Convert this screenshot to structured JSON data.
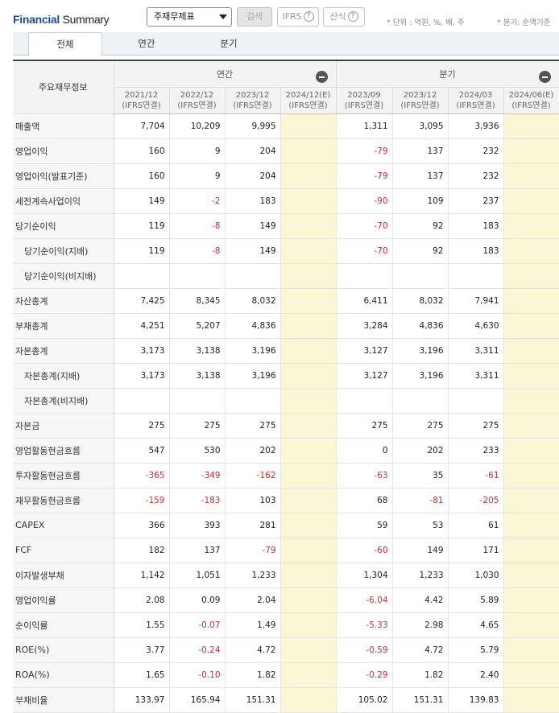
{
  "header": {
    "title_bold": "Financial",
    "title_rest": " Summary",
    "select_value": "주재무제표",
    "search_label": "검색",
    "ifrs_label": "IFRS",
    "calc_label": "산식",
    "help_glyph": "?",
    "unit_note": "* 단위 : 억원, %, 배, 주",
    "quarter_note": "* 분기: 순액기준"
  },
  "tabs": [
    "전체",
    "연간",
    "분기"
  ],
  "table": {
    "label_header": "주요재무정보",
    "annual_label": "연간",
    "quarter_label": "분기",
    "periods": [
      {
        "date": "2021/12",
        "basis": "(IFRS연결)"
      },
      {
        "date": "2022/12",
        "basis": "(IFRS연결)"
      },
      {
        "date": "2023/12",
        "basis": "(IFRS연결)"
      },
      {
        "date": "2024/12(E)",
        "basis": "(IFRS연결)"
      },
      {
        "date": "2023/09",
        "basis": "(IFRS연결)"
      },
      {
        "date": "2023/12",
        "basis": "(IFRS연결)"
      },
      {
        "date": "2024/03",
        "basis": "(IFRS연결)"
      },
      {
        "date": "2024/06(E)",
        "basis": "(IFRS연결)"
      }
    ],
    "rows": [
      {
        "label": "매출액",
        "indent": false,
        "values": [
          "7,704",
          "10,209",
          "9,995",
          "",
          "1,311",
          "3,095",
          "3,936",
          ""
        ]
      },
      {
        "label": "영업이익",
        "indent": false,
        "values": [
          "160",
          "9",
          "204",
          "",
          "-79",
          "137",
          "232",
          ""
        ]
      },
      {
        "label": "영업이익(발표기준)",
        "indent": false,
        "values": [
          "160",
          "9",
          "204",
          "",
          "-79",
          "137",
          "232",
          ""
        ]
      },
      {
        "label": "세전계속사업이익",
        "indent": false,
        "values": [
          "149",
          "-2",
          "183",
          "",
          "-90",
          "109",
          "237",
          ""
        ]
      },
      {
        "label": "당기순이익",
        "indent": false,
        "values": [
          "119",
          "-8",
          "149",
          "",
          "-70",
          "92",
          "183",
          ""
        ]
      },
      {
        "label": "당기순이익(지배)",
        "indent": true,
        "values": [
          "119",
          "-8",
          "149",
          "",
          "-70",
          "92",
          "183",
          ""
        ]
      },
      {
        "label": "당기순이익(비지배)",
        "indent": true,
        "values": [
          "",
          "",
          "",
          "",
          "",
          "",
          "",
          ""
        ]
      },
      {
        "label": "자산총계",
        "indent": false,
        "values": [
          "7,425",
          "8,345",
          "8,032",
          "",
          "6,411",
          "8,032",
          "7,941",
          ""
        ]
      },
      {
        "label": "부채총계",
        "indent": false,
        "values": [
          "4,251",
          "5,207",
          "4,836",
          "",
          "3,284",
          "4,836",
          "4,630",
          ""
        ]
      },
      {
        "label": "자본총계",
        "indent": false,
        "values": [
          "3,173",
          "3,138",
          "3,196",
          "",
          "3,127",
          "3,196",
          "3,311",
          ""
        ]
      },
      {
        "label": "자본총계(지배)",
        "indent": true,
        "values": [
          "3,173",
          "3,138",
          "3,196",
          "",
          "3,127",
          "3,196",
          "3,311",
          ""
        ]
      },
      {
        "label": "자본총계(비지배)",
        "indent": true,
        "values": [
          "",
          "",
          "",
          "",
          "",
          "",
          "",
          ""
        ]
      },
      {
        "label": "자본금",
        "indent": false,
        "values": [
          "275",
          "275",
          "275",
          "",
          "275",
          "275",
          "275",
          ""
        ]
      },
      {
        "label": "영업활동현금흐름",
        "indent": false,
        "values": [
          "547",
          "530",
          "202",
          "",
          "0",
          "202",
          "233",
          ""
        ]
      },
      {
        "label": "투자활동현금흐름",
        "indent": false,
        "values": [
          "-365",
          "-349",
          "-162",
          "",
          "-63",
          "35",
          "-61",
          ""
        ]
      },
      {
        "label": "재무활동현금흐름",
        "indent": false,
        "values": [
          "-159",
          "-183",
          "103",
          "",
          "68",
          "-81",
          "-205",
          ""
        ]
      },
      {
        "label": "CAPEX",
        "indent": false,
        "values": [
          "366",
          "393",
          "281",
          "",
          "59",
          "53",
          "61",
          ""
        ]
      },
      {
        "label": "FCF",
        "indent": false,
        "values": [
          "182",
          "137",
          "-79",
          "",
          "-60",
          "149",
          "171",
          ""
        ]
      },
      {
        "label": "이자발생부채",
        "indent": false,
        "values": [
          "1,142",
          "1,051",
          "1,233",
          "",
          "1,304",
          "1,233",
          "1,030",
          ""
        ]
      },
      {
        "label": "영업이익률",
        "indent": false,
        "values": [
          "2.08",
          "0.09",
          "2.04",
          "",
          "-6.04",
          "4.42",
          "5.89",
          ""
        ]
      },
      {
        "label": "순이익률",
        "indent": false,
        "values": [
          "1.55",
          "-0.07",
          "1.49",
          "",
          "-5.33",
          "2.98",
          "4.65",
          ""
        ]
      },
      {
        "label": "ROE(%)",
        "indent": false,
        "values": [
          "3.77",
          "-0.24",
          "4.72",
          "",
          "-0.59",
          "4.72",
          "5.79",
          ""
        ]
      },
      {
        "label": "ROA(%)",
        "indent": false,
        "values": [
          "1.65",
          "-0.10",
          "1.82",
          "",
          "-0.29",
          "1.82",
          "2.40",
          ""
        ]
      },
      {
        "label": "부채비율",
        "indent": false,
        "values": [
          "133.97",
          "165.94",
          "151.31",
          "",
          "105.02",
          "151.31",
          "139.83",
          ""
        ]
      }
    ]
  },
  "colors": {
    "title_blue": "#1c4e9e",
    "negative": "#d32b2b",
    "estimate_bg": "#fbf6d3",
    "header_bg": "#f3f3f3"
  }
}
